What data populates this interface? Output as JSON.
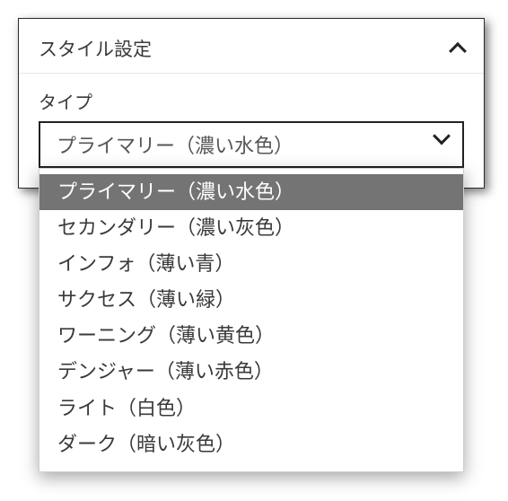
{
  "panel": {
    "title": "スタイル設定"
  },
  "field": {
    "label": "タイプ"
  },
  "select": {
    "value": "プライマリー（濃い水色）"
  },
  "options": [
    {
      "label": "プライマリー（濃い水色）",
      "selected": true
    },
    {
      "label": "セカンダリー（濃い灰色）",
      "selected": false
    },
    {
      "label": "インフォ（薄い青）",
      "selected": false
    },
    {
      "label": "サクセス（薄い緑）",
      "selected": false
    },
    {
      "label": "ワーニング（薄い黄色）",
      "selected": false
    },
    {
      "label": "デンジャー（薄い赤色）",
      "selected": false
    },
    {
      "label": "ライト（白色）",
      "selected": false
    },
    {
      "label": "ダーク（暗い灰色）",
      "selected": false
    }
  ]
}
